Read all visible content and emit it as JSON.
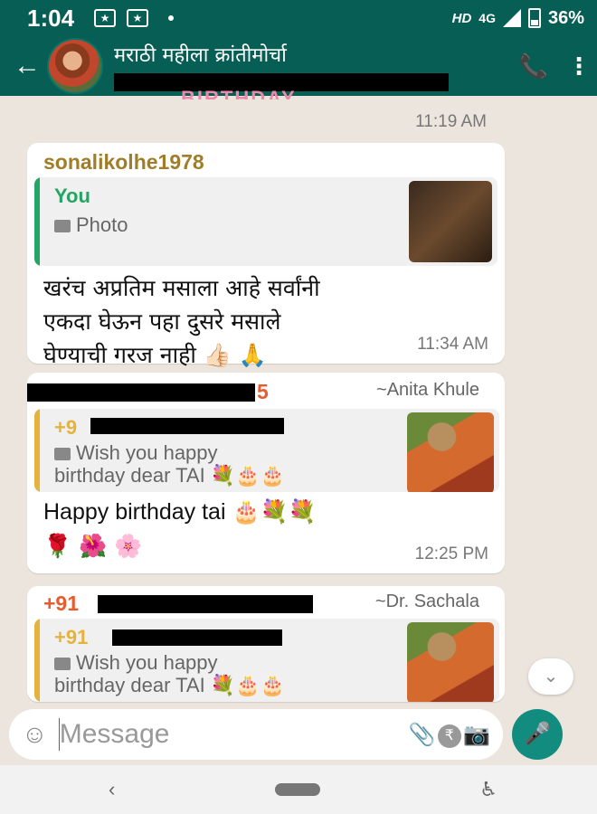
{
  "status_bar": {
    "time": "1:04",
    "hd": "HD",
    "network": "4G",
    "battery": "36%"
  },
  "header": {
    "group_name": "मराठी महीला क्रांतीमोर्चा"
  },
  "messages": [
    {
      "type": "sticker_tail",
      "time": "11:19 AM",
      "sticker_text": "BIRTHDAY"
    },
    {
      "sender": "sonalikolhe1978",
      "quote": {
        "name": "You",
        "text": "Photo"
      },
      "text_lines": [
        "खरंच अप्रतिम मसाला आहे सर्वांनी",
        "एकदा घेऊन पहा दुसरे मसाले",
        "घेण्याची गरज नाही 👍🏻 🙏"
      ],
      "time": "11:34 AM"
    },
    {
      "sender_suffix": "5",
      "alias": "~Anita Khule",
      "quote": {
        "name": "+9",
        "text_lines": [
          "Wish you happy",
          "birthday dear TAI 💐🎂🎂"
        ]
      },
      "text_lines": [
        "Happy birthday tai 🎂💐💐",
        "🌹 🌺 🌸"
      ],
      "time": "12:25 PM"
    },
    {
      "sender": "+91",
      "alias": "~Dr. Sachala",
      "quote": {
        "name": "+91",
        "text_lines": [
          "Wish you happy",
          "birthday dear TAI 💐🎂🎂"
        ]
      }
    }
  ],
  "input": {
    "placeholder": "Message"
  },
  "icons": {
    "back": "arrow-left-icon",
    "call": "add-call-icon",
    "more": "more-vert-icon",
    "emoji": "emoji-icon",
    "attach": "paperclip-icon",
    "payment": "rupee-icon",
    "camera": "camera-icon",
    "mic": "mic-icon",
    "scroll": "chevron-double-down-icon"
  },
  "colors": {
    "header": "#075e54",
    "accent": "#128c7e",
    "quote_you": "#25a565",
    "quote_other": "#e5b33b",
    "sender": "#a07d28"
  }
}
